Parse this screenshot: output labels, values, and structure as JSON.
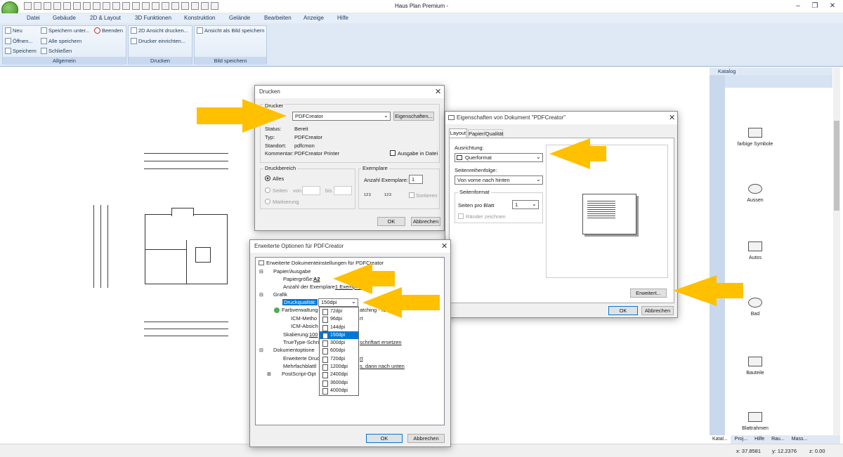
{
  "app": {
    "title": "Haus Plan Premium -"
  },
  "menu": [
    "Datei",
    "Gebäude",
    "2D & Layout",
    "3D Funktionen",
    "Konstruktion",
    "Gelände",
    "Bearbeiten",
    "Anzeige",
    "Hilfe"
  ],
  "ribbon": {
    "groups": [
      {
        "title": "Allgemein",
        "buttons": [
          "Neu",
          "Öffnen...",
          "Speichern",
          "Speichern unter...",
          "Alle speichern",
          "Schließen",
          "Beenden"
        ]
      },
      {
        "title": "Drucken",
        "buttons": [
          "2D Ansicht drucken...",
          "Drucker einrichten..."
        ]
      },
      {
        "title": "Bild speichern",
        "buttons": [
          "Ansicht als Bild speichern"
        ]
      }
    ]
  },
  "catalog": {
    "title": "Katalog",
    "items": [
      "farbige Symbole",
      "Aussen",
      "Autos",
      "Bad",
      "Bauteile",
      "Blattrahmen"
    ],
    "tabs": [
      "Katal...",
      "Proj...",
      "Hilfe",
      "Rau...",
      "Mass..."
    ]
  },
  "status": {
    "x": "x: 37.8581",
    "y": "y: 12.2376",
    "z": "z: 0.00"
  },
  "drucken": {
    "title": "Drucken",
    "printer_group": "Drucker",
    "printer": "PDFCreator",
    "properties_btn": "Eigenschaften...",
    "status_label": "Status:",
    "status_value": "Bereit",
    "type_label": "Typ:",
    "type_value": "PDFCreator",
    "location_label": "Standort:",
    "location_value": "pdfcmon",
    "comment_label": "Kommentar:",
    "comment_value": "PDFCreator Printer",
    "print_to_file": "Ausgabe in Datei",
    "range_group": "Druckbereich",
    "all": "Alles",
    "pages": "Seiten",
    "from": "von",
    "to": "bis",
    "selection": "Markierung",
    "copies_group": "Exemplare",
    "copies_label": "Anzahl Exemplare:",
    "copies_value": "1",
    "collate": "Sortieren",
    "ok": "OK",
    "cancel": "Abbrechen"
  },
  "eigenschaften": {
    "title": "Eigenschaften von Dokument \"PDFCreator\"",
    "tabs": [
      "Layout",
      "Papier/Qualität"
    ],
    "orientation_label": "Ausrichtung:",
    "orientation_value": "Querformat",
    "page_order_label": "Seitenreihenfolge:",
    "page_order_value": "Von vorne nach hinten",
    "page_format_group": "Seitenformat",
    "pages_per_sheet_label": "Seiten pro Blatt",
    "pages_per_sheet_value": "1",
    "borders": "Ränder zeichnen",
    "advanced": "Erweitert...",
    "ok": "OK",
    "cancel": "Abbrechen"
  },
  "erweitert": {
    "title": "Erweiterte Optionen für PDFCreator",
    "tree": {
      "root": "Erweiterte Dokumenteinstellungen für PDFCreator",
      "paper": "Papier/Ausgabe",
      "paper_size_label": "Papiergröße:",
      "paper_size_value": "A2",
      "copies_label": "Anzahl der Exemplare:",
      "copies_value": "1 Exemplar",
      "graphic": "Grafik",
      "quality_label": "Druckqualität:",
      "quality_value": "150dpi",
      "color_mgmt": "Farbverwaltung",
      "color_mgmt_tail": "atching - ICM",
      "icm_method": "ICM-Metho",
      "icm_method_tail": "rt",
      "icm_intent": "ICM-Absich",
      "icm_intent_tail": "",
      "scaling": "Skalierung:",
      "scaling_value": "100",
      "truetype": "TrueType-Schri",
      "truetype_tail": "schriftart ersetzen",
      "doc_options": "Dokumentoptione",
      "adv_print": "Erweiterte Druc",
      "adv_print_tail": "rt",
      "multi": "Mehrfachblattl",
      "multi_tail": "s, dann nach unten",
      "postscript": "PostScript-Opt"
    },
    "dpi_options": [
      "72dpi",
      "96dpi",
      "144dpi",
      "150dpi",
      "300dpi",
      "600dpi",
      "720dpi",
      "1200dpi",
      "2400dpi",
      "3600dpi",
      "4000dpi"
    ],
    "ok": "OK",
    "cancel": "Abbrechen"
  },
  "colors": {
    "arrow": "#ffc000",
    "accent": "#0078d7"
  }
}
